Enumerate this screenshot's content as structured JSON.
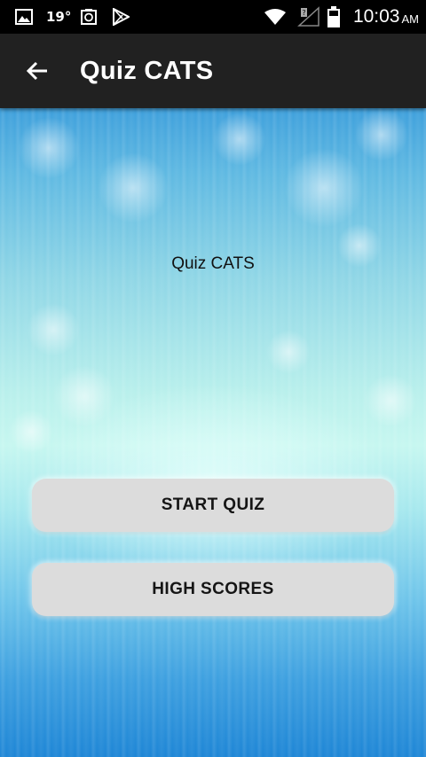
{
  "status_bar": {
    "temperature": "19°",
    "time": "10:03",
    "ampm": "AM",
    "icons": [
      "image-icon",
      "clipboard-icon",
      "play-store-icon",
      "wifi-icon",
      "signal-icon",
      "battery-icon"
    ]
  },
  "app_bar": {
    "title": "Quiz CATS",
    "back_icon": "arrow-back-icon"
  },
  "main": {
    "heading": "Quiz CATS",
    "start_button": "START QUIZ",
    "scores_button": "HIGH SCORES"
  },
  "colors": {
    "status_bar": "#000000",
    "app_bar": "#212121",
    "button": "#dcdcdc",
    "background_top": "#3fa0dc",
    "background_mid": "#c6f7f0",
    "background_bottom": "#1e86d6"
  }
}
